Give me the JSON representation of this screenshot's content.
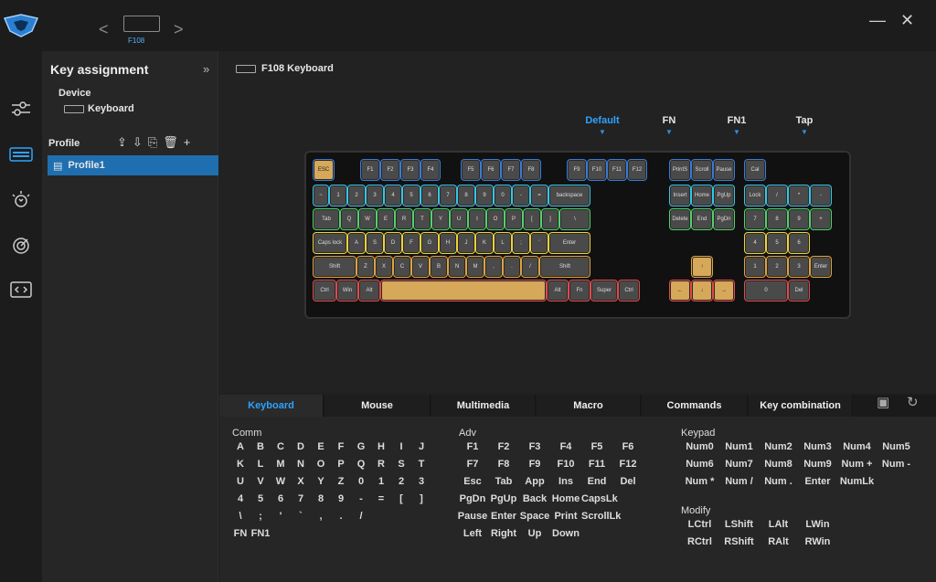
{
  "topbar": {
    "device_label": "F108",
    "nav_prev": "<",
    "nav_next": ">",
    "minimize": "—",
    "close": "✕"
  },
  "panel": {
    "title": "Key assignment",
    "collapse": "»",
    "device_label": "Device",
    "device_name": "Keyboard",
    "profile_label": "Profile",
    "profile_name": "Profile1"
  },
  "main": {
    "title": "F108 Keyboard",
    "layers": [
      "Default",
      "FN",
      "FN1",
      "Tap"
    ]
  },
  "tabs": [
    "Keyboard",
    "Mouse",
    "Multimedia",
    "Macro",
    "Commands",
    "Key combination"
  ],
  "comm": {
    "title": "Comm",
    "keys": [
      "A",
      "B",
      "C",
      "D",
      "E",
      "F",
      "G",
      "H",
      "I",
      "J",
      "K",
      "L",
      "M",
      "N",
      "O",
      "P",
      "Q",
      "R",
      "S",
      "T",
      "U",
      "V",
      "W",
      "X",
      "Y",
      "Z",
      "0",
      "1",
      "2",
      "3",
      "4",
      "5",
      "6",
      "7",
      "8",
      "9",
      "-",
      "=",
      "[",
      "]",
      "\\",
      ";",
      "'",
      "`",
      ",",
      ".",
      "/",
      "",
      "",
      "",
      "FN",
      "FN1"
    ]
  },
  "adv": {
    "title": "Adv",
    "keys": [
      "F1",
      "F2",
      "F3",
      "F4",
      "F5",
      "F6",
      "F7",
      "F8",
      "F9",
      "F10",
      "F11",
      "F12",
      "Esc",
      "Tab",
      "App",
      "Ins",
      "End",
      "Del",
      "PgDn",
      "PgUp",
      "Back",
      "Home",
      "CapsLk",
      "",
      "Pause",
      "Enter",
      "Space",
      "Print",
      "ScrollLk",
      "",
      "Left",
      "Right",
      "Up",
      "Down"
    ]
  },
  "keypad": {
    "title": "Keypad",
    "keys": [
      "Num0",
      "Num1",
      "Num2",
      "Num3",
      "Num4",
      "Num5",
      "Num6",
      "Num7",
      "Num8",
      "Num9",
      "Num +",
      "Num -",
      "Num *",
      "Num /",
      "Num .",
      "Enter",
      "NumLk"
    ]
  },
  "modify": {
    "title": "Modify",
    "keys": [
      "LCtrl",
      "LShift",
      "LAlt",
      "LWin",
      "RCtrl",
      "RShift",
      "RAlt",
      "RWin"
    ]
  },
  "keyboard_keys": {
    "row0": [
      "ESC",
      "F1",
      "F2",
      "F3",
      "F4",
      "F5",
      "F6",
      "F7",
      "F8",
      "F9",
      "F10",
      "F11",
      "F12",
      "PrintS",
      "Scroll",
      "Pause",
      "Cal"
    ],
    "row1": [
      "~",
      "1",
      "2",
      "3",
      "4",
      "5",
      "6",
      "7",
      "8",
      "9",
      "0",
      "-",
      "=",
      "backspace",
      "Insert",
      "Home",
      "PgUp",
      "Lock",
      "/",
      "*",
      "-"
    ],
    "row2": [
      "Tab",
      "Q",
      "W",
      "E",
      "R",
      "T",
      "Y",
      "U",
      "I",
      "O",
      "P",
      "[",
      "]",
      "\\",
      "Delete",
      "End",
      "PgDn",
      "7",
      "8",
      "9",
      "+"
    ],
    "row3": [
      "Caps lock",
      "A",
      "S",
      "D",
      "F",
      "G",
      "H",
      "J",
      "K",
      "L",
      ";",
      "'",
      "Enter",
      "4",
      "5",
      "6"
    ],
    "row4": [
      "Shift",
      "Z",
      "X",
      "C",
      "V",
      "B",
      "N",
      "M",
      ",",
      ".",
      "/",
      "Shift",
      "↑",
      "1",
      "2",
      "3",
      "Enter"
    ],
    "row5": [
      "Ctrl",
      "Win",
      "Alt",
      "",
      "Alt",
      "Fn",
      "Super",
      "Ctrl",
      "←",
      "↓",
      "→",
      "0",
      "Del"
    ]
  },
  "colors": {
    "accent": "#2ea3ff",
    "selected_profile": "#1f6fb0",
    "spacebar": "#d6a85a"
  }
}
